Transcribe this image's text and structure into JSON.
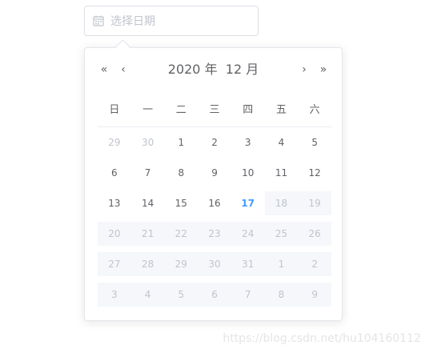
{
  "input": {
    "placeholder": "选择日期"
  },
  "header": {
    "year": "2020",
    "year_suffix": "年",
    "month": "12",
    "month_suffix": "月",
    "prev_year": "«",
    "prev_month": "‹",
    "next_month": "›",
    "next_year": "»"
  },
  "weekdays": [
    "日",
    "一",
    "二",
    "三",
    "四",
    "五",
    "六"
  ],
  "days": [
    [
      {
        "d": "29",
        "s": "other"
      },
      {
        "d": "30",
        "s": "other"
      },
      {
        "d": "1",
        "s": "normal"
      },
      {
        "d": "2",
        "s": "normal"
      },
      {
        "d": "3",
        "s": "normal"
      },
      {
        "d": "4",
        "s": "normal"
      },
      {
        "d": "5",
        "s": "normal"
      }
    ],
    [
      {
        "d": "6",
        "s": "normal"
      },
      {
        "d": "7",
        "s": "normal"
      },
      {
        "d": "8",
        "s": "normal"
      },
      {
        "d": "9",
        "s": "normal"
      },
      {
        "d": "10",
        "s": "normal"
      },
      {
        "d": "11",
        "s": "normal"
      },
      {
        "d": "12",
        "s": "normal"
      }
    ],
    [
      {
        "d": "13",
        "s": "normal"
      },
      {
        "d": "14",
        "s": "normal"
      },
      {
        "d": "15",
        "s": "normal"
      },
      {
        "d": "16",
        "s": "normal"
      },
      {
        "d": "17",
        "s": "today"
      },
      {
        "d": "18",
        "s": "disabled"
      },
      {
        "d": "19",
        "s": "disabled"
      }
    ],
    [
      {
        "d": "20",
        "s": "disabled"
      },
      {
        "d": "21",
        "s": "disabled"
      },
      {
        "d": "22",
        "s": "disabled"
      },
      {
        "d": "23",
        "s": "disabled"
      },
      {
        "d": "24",
        "s": "disabled"
      },
      {
        "d": "25",
        "s": "disabled"
      },
      {
        "d": "26",
        "s": "disabled"
      }
    ],
    [
      {
        "d": "27",
        "s": "disabled"
      },
      {
        "d": "28",
        "s": "disabled"
      },
      {
        "d": "29",
        "s": "disabled"
      },
      {
        "d": "30",
        "s": "disabled"
      },
      {
        "d": "31",
        "s": "disabled"
      },
      {
        "d": "1",
        "s": "disabled"
      },
      {
        "d": "2",
        "s": "disabled"
      }
    ],
    [
      {
        "d": "3",
        "s": "disabled"
      },
      {
        "d": "4",
        "s": "disabled"
      },
      {
        "d": "5",
        "s": "disabled"
      },
      {
        "d": "6",
        "s": "disabled"
      },
      {
        "d": "7",
        "s": "disabled"
      },
      {
        "d": "8",
        "s": "disabled"
      },
      {
        "d": "9",
        "s": "disabled"
      }
    ]
  ],
  "watermark": "https://blog.csdn.net/hu104160112",
  "colors": {
    "today": "#409eff",
    "disabled_bg": "#f5f7fa"
  }
}
